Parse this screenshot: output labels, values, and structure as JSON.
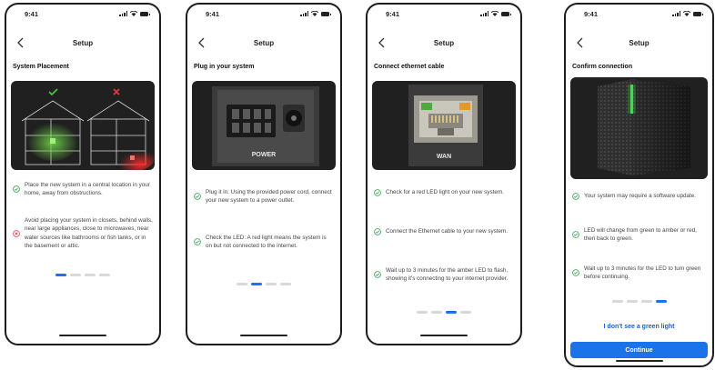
{
  "colors": {
    "accent": "#1a73e8",
    "success": "#2e9e4d",
    "error": "#e0393e",
    "frame": "#1d1d1f"
  },
  "screens": [
    {
      "status_time": "9:41",
      "nav_title": "Setup",
      "step_title": "System Placement",
      "hero_icon": "house-placement-illustration",
      "items": [
        {
          "icon": "check-circle-icon",
          "text": "Place the new system in a central location in your home, away from obstructions."
        },
        {
          "icon": "error-circle-icon",
          "text": "Avoid placing your system in closets, behind walls, near large appliances, close to microwaves, near water sources like bathrooms or fish tanks, or in the basement or attic."
        }
      ],
      "page_index": 1,
      "page_count": 4
    },
    {
      "status_time": "9:41",
      "nav_title": "Setup",
      "step_title": "Plug in your system",
      "hero_icon": "power-port-photo",
      "hero_label": "POWER",
      "items": [
        {
          "icon": "check-circle-icon",
          "text": "Plug it in: Using the provided power cord, connect your new system to a power outlet."
        },
        {
          "icon": "check-circle-icon",
          "text": "Check the LED: A red light means the system is on but not connected to the internet."
        }
      ],
      "page_index": 2,
      "page_count": 4
    },
    {
      "status_time": "9:41",
      "nav_title": "Setup",
      "step_title": "Connect ethernet cable",
      "hero_icon": "ethernet-port-photo",
      "hero_label": "WAN",
      "items": [
        {
          "icon": "check-circle-icon",
          "text": "Check for a red LED light on your new system."
        },
        {
          "icon": "check-circle-icon",
          "text": "Connect the Ethernet cable to your new system."
        },
        {
          "icon": "check-circle-icon",
          "text": "Wait up to 3 minutes for the amber LED to flash, showing it's connecting to your internet provider."
        }
      ],
      "page_index": 3,
      "page_count": 4
    },
    {
      "status_time": "9:41",
      "nav_title": "Setup",
      "step_title": "Confirm connection",
      "hero_icon": "router-device-photo",
      "items": [
        {
          "icon": "check-circle-icon",
          "text": "Your system may require a software update."
        },
        {
          "icon": "check-circle-icon",
          "text": "LED will change from green to amber or red, then back to green."
        },
        {
          "icon": "check-circle-icon",
          "text": "Wait up to 3 minutes for the LED to turn green before continuing."
        }
      ],
      "page_index": 4,
      "page_count": 4,
      "link_label": "I don't see a green light",
      "primary_label": "Continue"
    }
  ]
}
